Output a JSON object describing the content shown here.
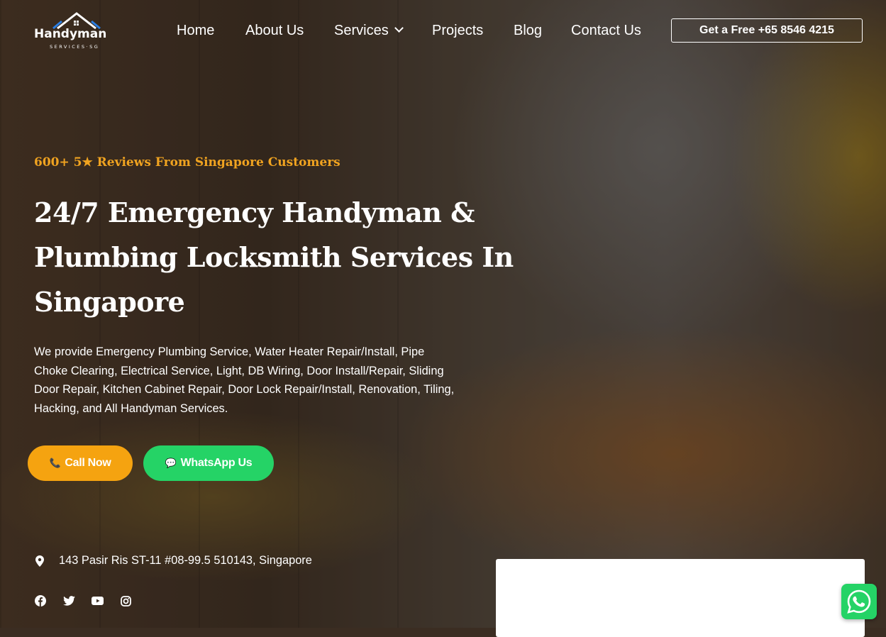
{
  "brand": {
    "name": "Handyman",
    "tagline": "SERVICES·SG"
  },
  "nav": {
    "items": [
      "Home",
      "About Us",
      "Services",
      "Projects",
      "Blog",
      "Contact Us"
    ],
    "cta_label": "Get a Free +65 8546 4215"
  },
  "hero": {
    "reviews": "600+ 5★ Reviews From Singapore Customers",
    "headline": "24/7 Emergency Handyman & Plumbing Locksmith Services In Singapore",
    "description": "We provide Emergency Plumbing Service, Water Heater Repair/Install, Pipe Choke Clearing, Electrical Service, Light, DB Wiring,  Door Install/Repair, Sliding Door Repair, Kitchen Cabinet Repair, Door Lock Repair/Install, Renovation, Tiling, Hacking, and All Handyman Services.",
    "call_label": "Call Now",
    "whatsapp_label": "WhatsApp Us"
  },
  "contact": {
    "address": "143 Pasir Ris ST-11 #08-99.5 510143, Singapore"
  },
  "social": [
    "facebook-icon",
    "twitter-icon",
    "youtube-icon",
    "instagram-icon"
  ],
  "colors": {
    "accent": "#f0a320",
    "call_button": "#f5a310",
    "whatsapp": "#25d366"
  }
}
